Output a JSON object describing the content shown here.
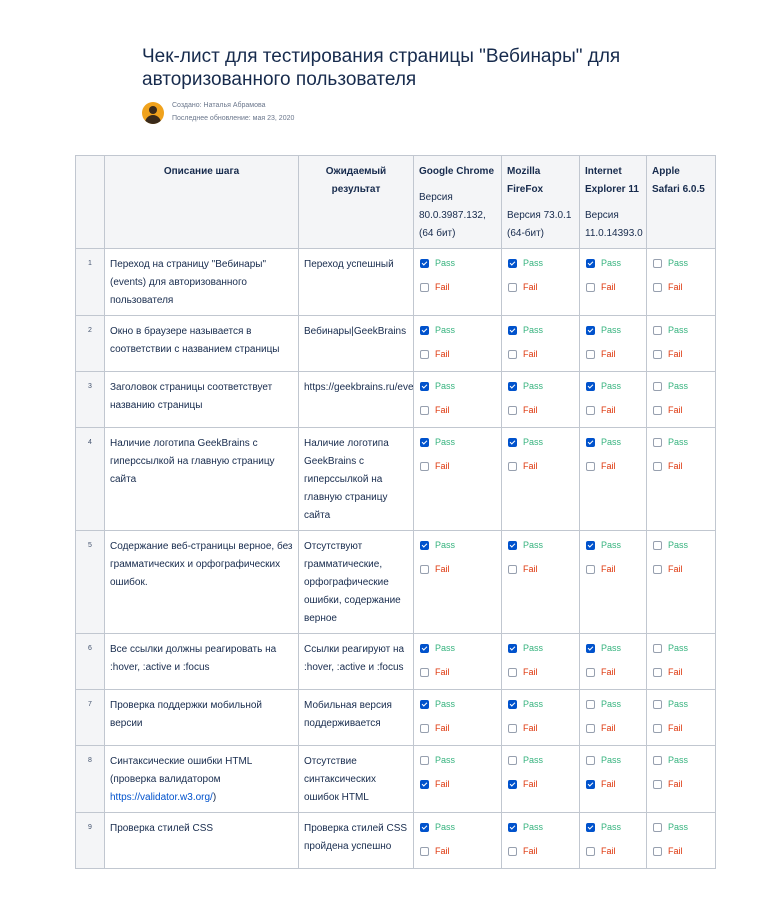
{
  "page": {
    "title": "Чек-лист для тестирования страницы \"Вебинары\" для авторизованного пользователя",
    "created_by": "Создано: Наталья Абрамова",
    "last_updated": "Последнее обновление: мая 23, 2020"
  },
  "table": {
    "headers": {
      "num": "",
      "step": "Описание шага",
      "expected": "Ожидаемый результат",
      "browsers": [
        {
          "name": "Google Chrome",
          "version": "Версия 80.0.3987.132, (64 бит)"
        },
        {
          "name": "Mozilla FireFox",
          "version": "Версия 73.0.1 (64-бит)"
        },
        {
          "name": "Internet Explorer 11",
          "version": "Версия 11.0.14393.0"
        },
        {
          "name": "Apple Safari 6.0.5",
          "version": ""
        }
      ]
    },
    "pass_label": "Pass",
    "fail_label": "Fail",
    "rows": [
      {
        "num": "1",
        "step": "Переход на страницу \"Вебинары\" (events) для авторизованного пользователя",
        "expected": "Переход успешный",
        "results": [
          [
            true,
            false
          ],
          [
            true,
            false
          ],
          [
            true,
            false
          ],
          [
            false,
            false
          ]
        ]
      },
      {
        "num": "2",
        "step": "Окно в браузере называется в соответствии с названием страницы",
        "expected": "Вебинары|GeekBrains",
        "results": [
          [
            true,
            false
          ],
          [
            true,
            false
          ],
          [
            true,
            false
          ],
          [
            false,
            false
          ]
        ]
      },
      {
        "num": "3",
        "step": "Заголовок страницы соответствует названию страницы",
        "expected": "https://geekbrains.ru/events",
        "results": [
          [
            true,
            false
          ],
          [
            true,
            false
          ],
          [
            true,
            false
          ],
          [
            false,
            false
          ]
        ]
      },
      {
        "num": "4",
        "step": "Наличие логотипа GeekBrains с гиперссылкой на главную страницу сайта",
        "expected": "Наличие логотипа GeekBrains с гиперссылкой на главную страницу сайта",
        "results": [
          [
            true,
            false
          ],
          [
            true,
            false
          ],
          [
            true,
            false
          ],
          [
            false,
            false
          ]
        ]
      },
      {
        "num": "5",
        "step": "Содержание веб-страницы верное, без грамматических и орфографических ошибок.",
        "expected": "Отсутствуют грамматические, орфографические ошибки, содержание верное",
        "results": [
          [
            true,
            false
          ],
          [
            true,
            false
          ],
          [
            true,
            false
          ],
          [
            false,
            false
          ]
        ]
      },
      {
        "num": "6",
        "step": "Все ссылки должны реагировать на :hover, :active и :focus",
        "expected": "Ссылки реагируют на :hover, :active и :focus",
        "results": [
          [
            true,
            false
          ],
          [
            true,
            false
          ],
          [
            true,
            false
          ],
          [
            false,
            false
          ]
        ]
      },
      {
        "num": "7",
        "step": "Проверка поддержки мобильной версии",
        "expected": "Мобильная версия поддерживается",
        "results": [
          [
            true,
            false
          ],
          [
            true,
            false
          ],
          [
            false,
            false
          ],
          [
            false,
            false
          ]
        ]
      },
      {
        "num": "8",
        "step": "Синтаксические ошибки HTML (проверка валидатором",
        "step_link": "https://validator.w3.org/",
        "step_suffix": ")",
        "expected": "Отсутствие синтаксических ошибок HTML",
        "results": [
          [
            false,
            true
          ],
          [
            false,
            true
          ],
          [
            false,
            true
          ],
          [
            false,
            false
          ]
        ]
      },
      {
        "num": "9",
        "step": "Проверка стилей CSS",
        "expected": "Проверка стилей CSS пройдена успешно",
        "results": [
          [
            true,
            false
          ],
          [
            true,
            false
          ],
          [
            true,
            false
          ],
          [
            false,
            false
          ]
        ]
      }
    ]
  }
}
